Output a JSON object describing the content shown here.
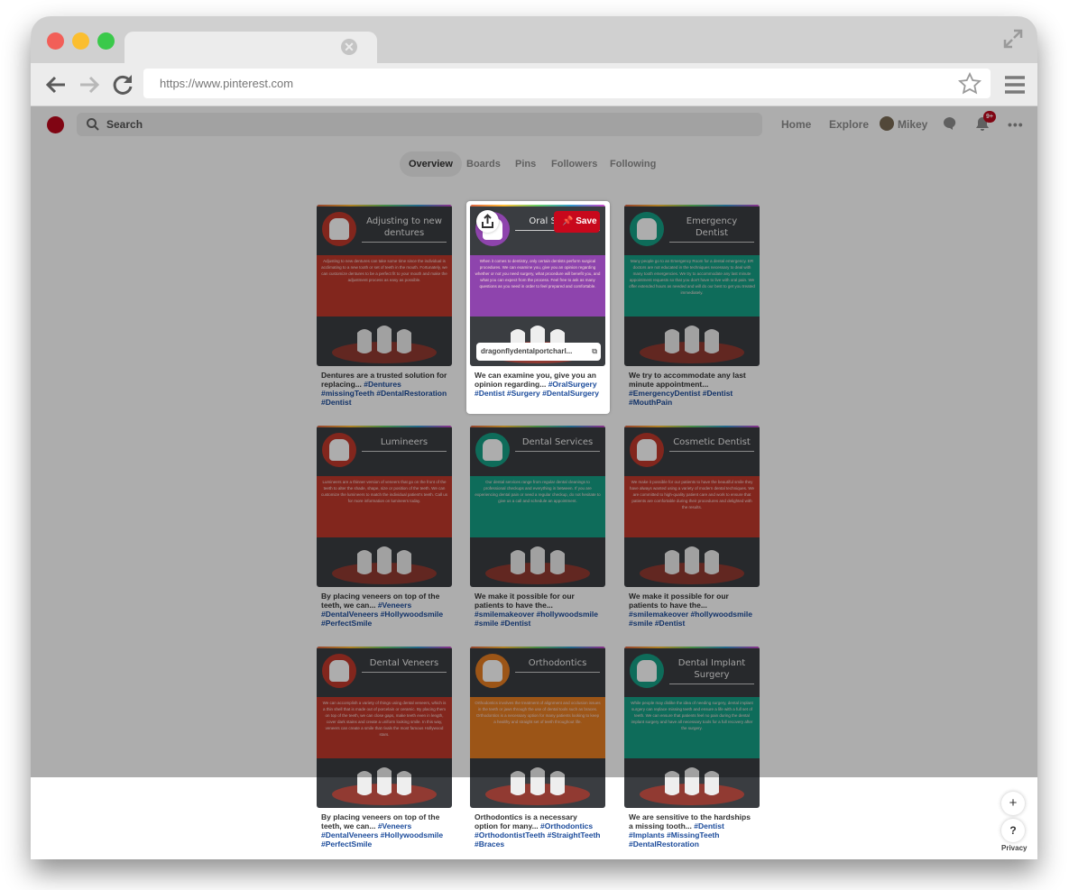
{
  "browser": {
    "url": "https://www.pinterest.com",
    "tab_close": "✕"
  },
  "pinterest": {
    "search_placeholder": "Search",
    "nav": {
      "home": "Home",
      "explore": "Explore",
      "user": "Mikey",
      "notif_badge": "9+",
      "more": "•••"
    },
    "tabs": [
      "Overview",
      "Boards",
      "Pins",
      "Followers",
      "Following"
    ],
    "active_tab": "Overview",
    "save_label": "Save",
    "source_link": "dragonflydentalportcharl...",
    "fab_plus": "+",
    "fab_help": "?",
    "privacy": "Privacy"
  },
  "pins": [
    {
      "title": "Adjusting to new dentures",
      "circle": "#c0392b",
      "band": "#c0392b",
      "body": "Adjusting to new dentures can take some time since the individual is acclimating to a new tooth or set of teeth in the mouth. Fortunately, we can customize dentures to be a perfect fit to your mouth and make the adjustment process as easy as possible.",
      "desc": "Dentures are a trusted solution for replacing... ",
      "tags": "#Dentures #missingTeeth #DentalRestoration #Dentist"
    },
    {
      "title": "Oral Surgery",
      "circle": "#8e44ad",
      "band": "#8e44ad",
      "body": "When it comes to dentistry, only certain dentists perform surgical procedures. We can examine you, give you an opinion regarding whether or not you need surgery, what procedure will benefit you, and what you can expect from the process. Feel free to ask as many questions as you need in order to feel prepared and comfortable.",
      "desc": "We can examine you, give you an opinion regarding... ",
      "tags": "#OralSurgery #Dentist #Surgery #DentalSurgery"
    },
    {
      "title": "Emergency Dentist",
      "circle": "#16a085",
      "band": "#16a085",
      "body": "Many people go to an Emergency Room for a dental emergency. ER doctors are not educated in the techniques necessary to deal with many tooth emergencies. We try to accommodate any last minute appointment requests so that you don't have to live with oral pain. We offer extended hours as needed and will do our best to get you treated immediately.",
      "desc": "We try to accommodate any last minute appointment... ",
      "tags": "#EmergencyDentist #Dentist #MouthPain"
    },
    {
      "title": "Lumineers",
      "circle": "#c0392b",
      "band": "#c0392b",
      "body": "Lumineers are a thinner version of veneers that go on the front of the teeth to alter the shade, shape, size or position of the teeth. We can customize the lumineers to match the individual patient's teeth. Call us for more information on lumineers today.",
      "desc": "By placing veneers on top of the teeth, we can... ",
      "tags": "#Veneers #DentalVeneers #Hollywoodsmile #PerfectSmile"
    },
    {
      "title": "Dental Services",
      "circle": "#16a085",
      "band": "#16a085",
      "body": "Our dental services range from regular dental cleanings to professional checkups and everything in between. If you are experiencing dental pain or need a regular checkup, do not hesitate to give us a call and schedule an appointment.",
      "desc": "We make it possible for our patients to have the... ",
      "tags": "#smilemakeover #hollywoodsmile #smile #Dentist"
    },
    {
      "title": "Cosmetic Dentist",
      "circle": "#c0392b",
      "band": "#c0392b",
      "body": "We make it possible for our patients to have the beautiful smile they have always wanted using a variety of modern dental techniques. We are committed to high-quality patient care and work to ensure that patients are comfortable during their procedures and delighted with the results.",
      "desc": "We make it possible for our patients to have the... ",
      "tags": "#smilemakeover #hollywoodsmile #smile #Dentist"
    },
    {
      "title": "Dental Veneers",
      "circle": "#c0392b",
      "band": "#c0392b",
      "body": "We can accomplish a variety of things using dental veneers, which is a thin shell that is made out of porcelain or ceramic. By placing them on top of the teeth, we can close gaps, make teeth even in length, cover dark stains and create a uniform looking smile. In this way, veneers can create a smile that rivals the most famous Hollywood stars.",
      "desc": "By placing veneers on top of the teeth, we can... ",
      "tags": "#Veneers #DentalVeneers #Hollywoodsmile #PerfectSmile"
    },
    {
      "title": "Orthodontics",
      "circle": "#e67e22",
      "band": "#e67e22",
      "body": "Orthodontics involves the treatment of alignment and occlusion issues in the teeth or jaws through the use of dental tools such as braces. Orthodontics is a necessary option for many patients looking to keep a healthy and straight set of teeth throughout life.",
      "desc": "Orthodontics is a necessary option for many... ",
      "tags": "#Orthodontics #OrthodontistTeeth #StraightTeeth #Braces"
    },
    {
      "title": "Dental Implant Surgery",
      "circle": "#16a085",
      "band": "#16a085",
      "body": "While people may dislike the idea of needing surgery, dental implant surgery can replace missing teeth and ensure a life with a full set of teeth. We can ensure that patients feel no pain during the dental implant surgery and have all necessary tools for a full recovery after the surgery.",
      "desc": "We are sensitive to the hardships a missing tooth... ",
      "tags": "#Dentist #Implants #MissingTeeth #DentalRestoration"
    }
  ]
}
